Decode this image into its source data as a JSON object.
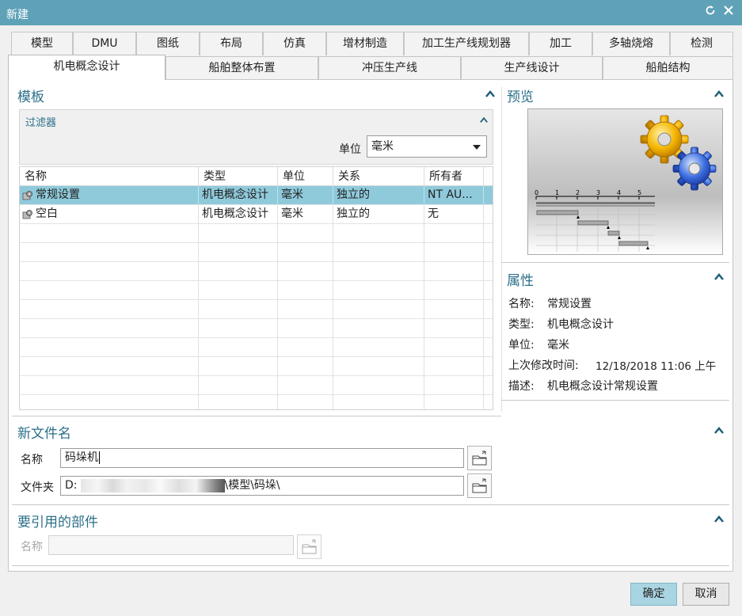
{
  "window": {
    "title": "新建"
  },
  "tabs_row1": [
    "模型",
    "DMU",
    "图纸",
    "布局",
    "仿真",
    "增材制造",
    "加工生产线规划器",
    "加工",
    "多轴烧熔",
    "检测"
  ],
  "tabs_row2": [
    "机电概念设计",
    "船舶整体布置",
    "冲压生产线",
    "生产线设计",
    "船舶结构"
  ],
  "templates": {
    "title": "模板",
    "filter": {
      "title": "过滤器",
      "unit_label": "单位",
      "unit_value": "毫米"
    },
    "columns": [
      "名称",
      "类型",
      "单位",
      "关系",
      "所有者"
    ],
    "rows": [
      {
        "name": "常规设置",
        "type": "机电概念设计",
        "unit": "毫米",
        "relation": "独立的",
        "owner": "NT AU..."
      },
      {
        "name": "空白",
        "type": "机电概念设计",
        "unit": "毫米",
        "relation": "独立的",
        "owner": "无"
      }
    ],
    "selected_row": 0
  },
  "preview": {
    "title": "预览",
    "timeline_ticks": [
      "0",
      "1",
      "2",
      "3",
      "4",
      "5"
    ]
  },
  "properties": {
    "title": "属性",
    "name_label": "名称:",
    "name_value": "常规设置",
    "type_label": "类型:",
    "type_value": "机电概念设计",
    "unit_label": "单位:",
    "unit_value": "毫米",
    "modified_label": "上次修改时间:",
    "modified_value": "12/18/2018 11:06 上午",
    "desc_label": "描述:",
    "desc_value": "机电概念设计常规设置"
  },
  "new_file": {
    "title": "新文件名",
    "name_label": "名称",
    "name_value": "码垛机",
    "folder_label": "文件夹",
    "folder_prefix": "D:",
    "folder_suffix": "\\模型\\码垛\\"
  },
  "referenced_parts": {
    "title": "要引用的部件",
    "name_label": "名称",
    "name_value": ""
  },
  "buttons": {
    "ok": "确定",
    "cancel": "取消"
  },
  "colors": {
    "titlebar": "#5fa2b8",
    "accent": "#2b6f89",
    "selection": "#8fcadb",
    "primary_button": "#a9d4e2"
  }
}
